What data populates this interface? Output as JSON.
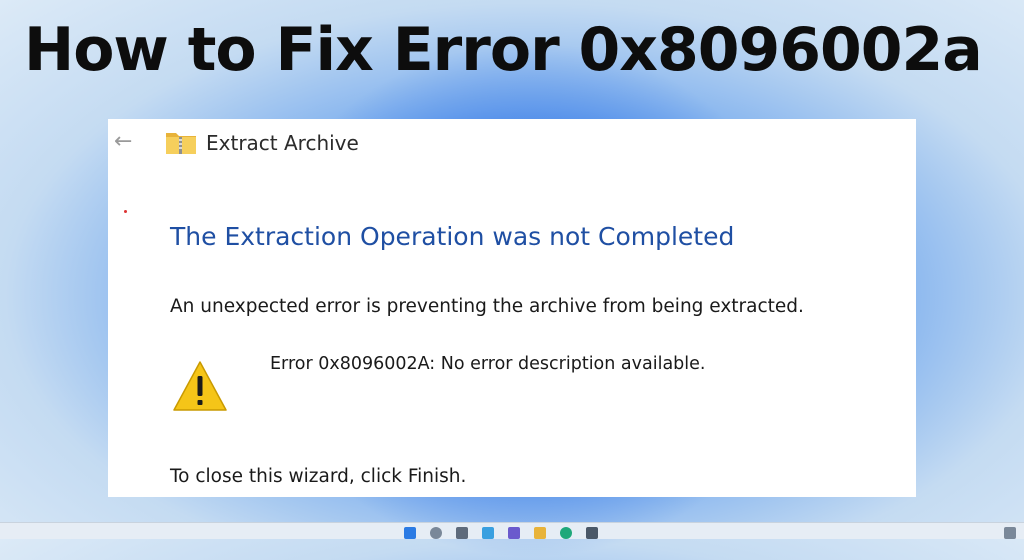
{
  "headline": "How to Fix Error 0x8096002a",
  "dialog": {
    "title": "Extract Archive",
    "heading": "The Extraction Operation was not Completed",
    "message": "An unexpected error is preventing the archive from being extracted.",
    "error_detail": "Error 0x8096002A: No error description available.",
    "footer": "To close this wizard, click Finish."
  },
  "icons": {
    "back": "arrow-left-icon",
    "folder": "zip-folder-icon",
    "warning": "warning-icon"
  },
  "colors": {
    "heading": "#1f4fa3",
    "warning": "#f5c518",
    "headline": "#0d0d0d"
  }
}
